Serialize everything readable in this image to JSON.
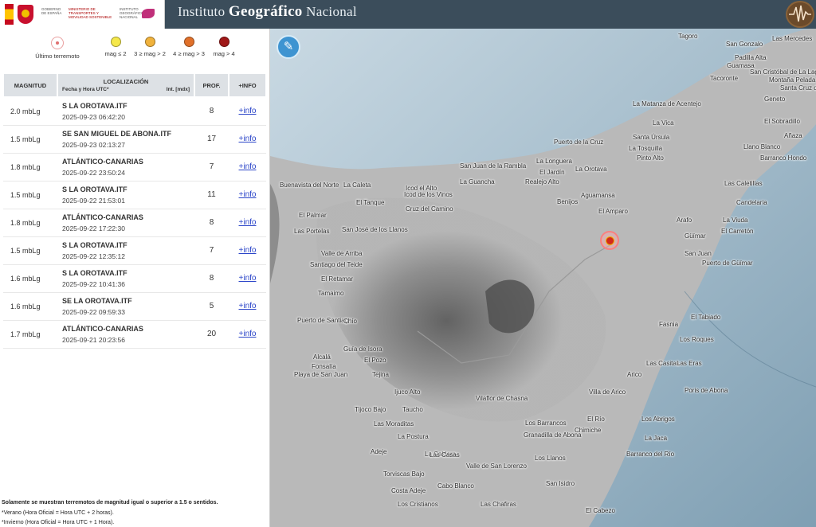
{
  "header": {
    "gov_line": "GOBIERNO DE ESPAÑA",
    "ministry_line": "MINISTERIO DE TRANSPORTES Y MOVILIDAD SOSTENIBLE",
    "ign_line": "INSTITUTO GEOGRÁFICO NACIONAL",
    "title_prefix": "Instituto ",
    "title_big": "Geográfico",
    "title_suffix": " Nacional"
  },
  "legend": {
    "last": "Último terremoto",
    "items": [
      {
        "label": "mag ≤ 2",
        "color": "#f5e84a"
      },
      {
        "label": "3 ≥ mag > 2",
        "color": "#f0b23c"
      },
      {
        "label": "4 ≥ mag > 3",
        "color": "#e0702a"
      },
      {
        "label": "mag > 4",
        "color": "#a01818"
      }
    ]
  },
  "table": {
    "headers": {
      "magnitude": "MAGNITUD",
      "location": "LOCALIZACIÓN",
      "datetime": "Fecha y Hora UTC*",
      "intensity": "Int. [mdx]",
      "depth": "PROF.",
      "info": "+INFO"
    },
    "rows": [
      {
        "mag": "2.0 mbLg",
        "place": "S LA OROTAVA.ITF",
        "date": "2025-09-23 06:42:20",
        "depth": "8",
        "info": "+info"
      },
      {
        "mag": "1.5 mbLg",
        "place": "SE SAN MIGUEL DE ABONA.ITF",
        "date": "2025-09-23 02:13:27",
        "depth": "17",
        "info": "+info"
      },
      {
        "mag": "1.8 mbLg",
        "place": "ATLÁNTICO-CANARIAS",
        "date": "2025-09-22 23:50:24",
        "depth": "7",
        "info": "+info"
      },
      {
        "mag": "1.5 mbLg",
        "place": "S LA OROTAVA.ITF",
        "date": "2025-09-22 21:53:01",
        "depth": "11",
        "info": "+info"
      },
      {
        "mag": "1.8 mbLg",
        "place": "ATLÁNTICO-CANARIAS",
        "date": "2025-09-22 17:22:30",
        "depth": "8",
        "info": "+info"
      },
      {
        "mag": "1.5 mbLg",
        "place": "S LA OROTAVA.ITF",
        "date": "2025-09-22 12:35:12",
        "depth": "7",
        "info": "+info"
      },
      {
        "mag": "1.6 mbLg",
        "place": "S LA OROTAVA.ITF",
        "date": "2025-09-22 10:41:36",
        "depth": "8",
        "info": "+info"
      },
      {
        "mag": "1.6 mbLg",
        "place": "SE LA OROTAVA.ITF",
        "date": "2025-09-22 09:59:33",
        "depth": "5",
        "info": "+info"
      },
      {
        "mag": "1.7 mbLg",
        "place": "ATLÁNTICO-CANARIAS",
        "date": "2025-09-21 20:23:56",
        "depth": "20",
        "info": "+info"
      }
    ]
  },
  "notes": {
    "line1": "Solamente se muestran terremotos de magnitud igual o superior a 1.5 o sentidos.",
    "line2": "*Verano (Hora Oficial = Hora UTC + 2 horas).",
    "line3": "*Invierno (Hora Oficial = Hora UTC + 1 Hora)."
  },
  "map": {
    "places": [
      "Tagoro",
      "San Gonzalo",
      "Las Mercedes",
      "Padilla Alta",
      "Guamasa",
      "San Cristóbal de La Laguna",
      "Tacoronte",
      "La Matanza de Acentejo",
      "La Vica",
      "Geneto",
      "El Sobradillo",
      "Santa Úrsula",
      "La Tosquilla",
      "Pinto Alto",
      "Puerto de la Cruz",
      "La Longuera",
      "El Jardín",
      "Añaza",
      "Llano Blanco",
      "Barranco Hondo",
      "San Juan de la Rambla",
      "La Guancha",
      "Icod el Alto",
      "La Orotava",
      "Realejo Alto",
      "Aguamansa",
      "Benijos",
      "El Amparo",
      "Buenavista del Norte",
      "La Caleta",
      "Icod de los Vinos",
      "El Tanque",
      "Cruz del Camino",
      "Candelaria",
      "Las Caletillas",
      "El Palmar",
      "Las Portelas",
      "San José de los Llanos",
      "Arafo",
      "La Viuda",
      "El Carretón",
      "Güímar",
      "Valle de Arriba",
      "Santiago del Teide",
      "El Retamar",
      "Tamaimo",
      "San Juan",
      "Puerto de Güímar",
      "Puerto de Santiago",
      "Chío",
      "Fasnia",
      "El Tabiado",
      "Los Roques",
      "Guía de Isora",
      "El Pozo",
      "Alcalá",
      "Fonsalía",
      "Playa de San Juan",
      "Tejina",
      "Las Casitas",
      "Las Eras",
      "Arico",
      "Ijuco Alto",
      "Vilaflor de Chasna",
      "Villa de Arico",
      "Poris de Abona",
      "Tijoco Bajo",
      "Taucho",
      "El Río",
      "Las Moraditas",
      "Los Barrancos",
      "Chimiche",
      "Los Abrigos",
      "La Postura",
      "Granadilla de Abona",
      "La Jaca",
      "Adeje",
      "La Caldera",
      "Las Casas",
      "Los Llanos",
      "Barranco del Río",
      "Valle de San Lorenzo",
      "Torviscas Bajo",
      "Cabo Blanco",
      "San Isidro",
      "Costa Adeje",
      "Los Cristianos",
      "Las Chafiras",
      "El Cabezo",
      "Montaña Pelada",
      "Santa Cruz de Tenerife"
    ]
  }
}
